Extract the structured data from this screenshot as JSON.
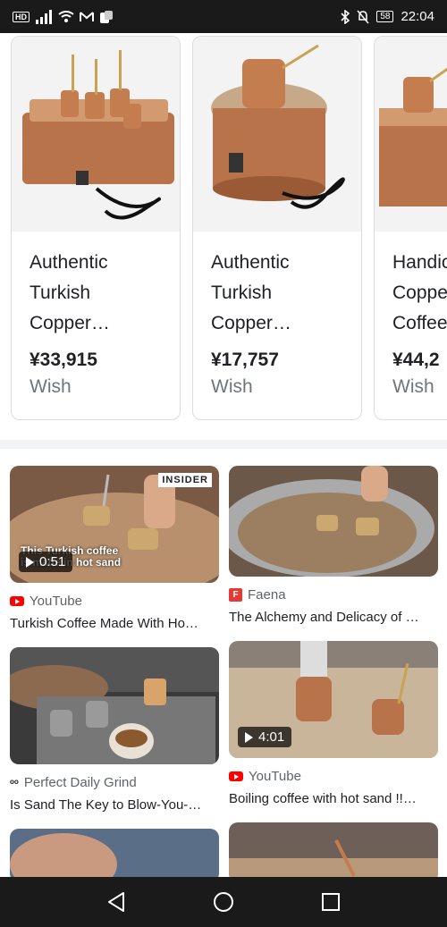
{
  "status_bar": {
    "hd": "HD",
    "battery": "58",
    "time": "22:04"
  },
  "products": [
    {
      "title": "Authentic\nTurkish\nCopper…",
      "price": "¥33,915",
      "wish": "Wish"
    },
    {
      "title": "Authentic\nTurkish\nCopper…",
      "price": "¥17,757",
      "wish": "Wish"
    },
    {
      "title": "Handic\nCoppe\nCoffee",
      "price": "¥44,2",
      "wish": "Wish"
    }
  ],
  "results": [
    {
      "source": "YouTube",
      "caption": "Turkish Coffee Made With Ho…",
      "duration": "0:51",
      "badge": "INSIDER",
      "overlay": "This Turkish coffee\nis made in hot sand"
    },
    {
      "source": "Faena",
      "caption": "The Alchemy and Delicacy of …"
    },
    {
      "source": "Perfect Daily Grind",
      "caption": "Is Sand The Key to Blow-You-…"
    },
    {
      "source": "YouTube",
      "caption": "Boiling coffee with hot sand !!…",
      "duration": "4:01"
    }
  ],
  "colors": {
    "status_bg": "#1a1a1a",
    "youtube_red": "#ff0000",
    "faena_red": "#e53935",
    "copper": "#b8734a"
  }
}
